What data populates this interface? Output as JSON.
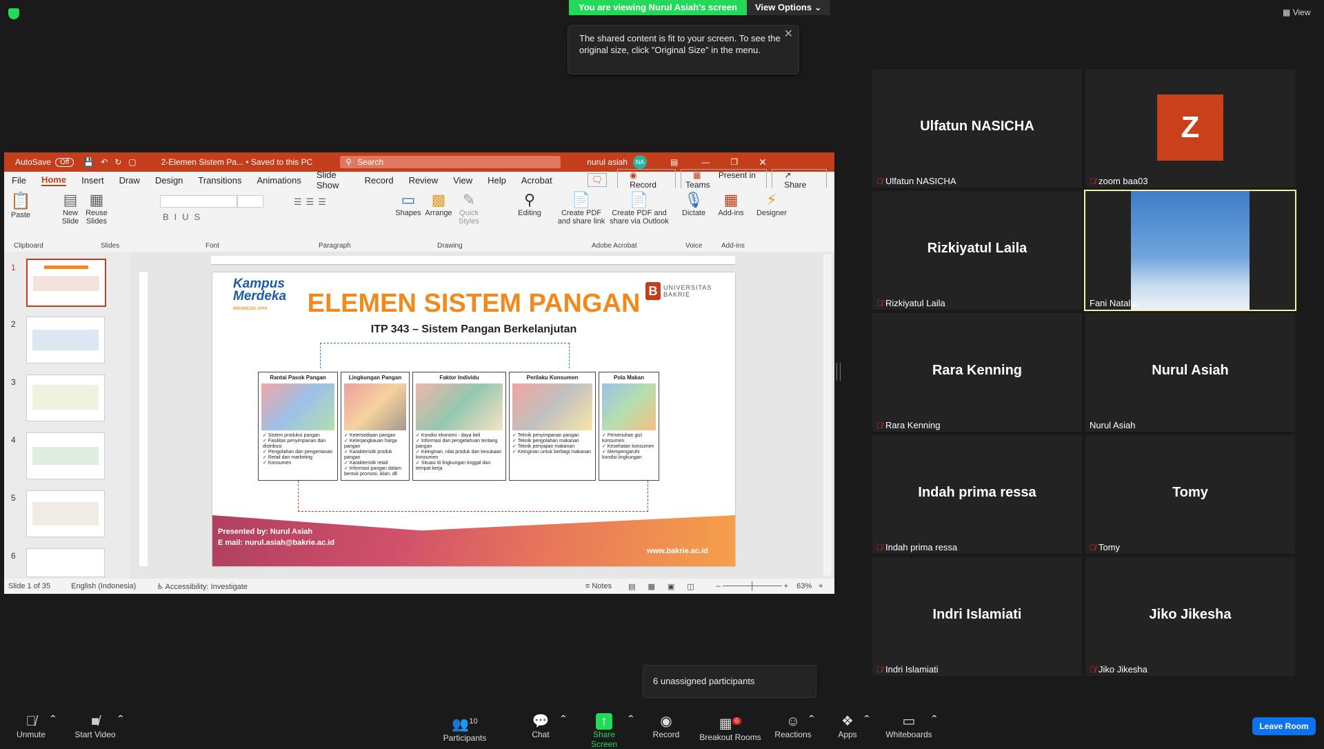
{
  "banner": {
    "viewing": "You are viewing Nurul Asiah's screen",
    "view_options": "View Options"
  },
  "tooltip": {
    "text": "The shared content is fit to your screen. To see the original size, click \"Original Size\" in the menu."
  },
  "top_view": "View",
  "ppt": {
    "autosave": "AutoSave",
    "autosave_state": "Off",
    "doc_title": "2-Elemen Sistem Pa... • Saved to this PC",
    "search": "Search",
    "user": "nurul asiah",
    "user_initials": "NA",
    "menu": [
      "File",
      "Home",
      "Insert",
      "Draw",
      "Design",
      "Transitions",
      "Animations",
      "Slide Show",
      "Record",
      "Review",
      "View",
      "Help",
      "Acrobat"
    ],
    "record_btn": "Record",
    "present_btn": "Present in Teams",
    "share_btn": "Share",
    "ribbon": {
      "paste": "Paste",
      "new_slide": "New Slide",
      "reuse_slides": "Reuse Slides",
      "shapes": "Shapes",
      "arrange": "Arrange",
      "quick_styles": "Quick Styles",
      "editing": "Editing",
      "create_pdf_link": "Create PDF and share link",
      "create_pdf_outlook": "Create PDF and share via Outlook",
      "dictate": "Dictate",
      "addins": "Add-ins",
      "designer": "Designer",
      "groups": [
        "Clipboard",
        "Slides",
        "Font",
        "Paragraph",
        "Drawing",
        "Adobe Acrobat",
        "Voice",
        "Add-ins"
      ]
    },
    "slide_numbers": [
      "1",
      "2",
      "3",
      "4",
      "5",
      "6"
    ],
    "slide": {
      "logo_left": "Kampus Merdeka",
      "logo_left_sub": "INDONESIA JAYA",
      "logo_right": "UNIVERSITAS BAKRIE",
      "title": "ELEMEN SISTEM PANGAN",
      "subtitle": "ITP 343 – Sistem Pangan Berkelanjutan",
      "boxes": [
        {
          "title": "Rantai Pasok Pangan",
          "items": [
            "Sistem produksi pangan",
            "Fasilitas penyimpanan dan distribusi",
            "Pengolahan dan pengemasan",
            "Retail dan marketing",
            "Konsumen"
          ]
        },
        {
          "title": "Lingkungan Pangan",
          "items": [
            "Ketersediaan pangan",
            "Keterjangkauan harga pangan",
            "Karakteristik produk pangan",
            "Karakteristik retail",
            "Informasi pangan dalam bentuk promosi, iklan, dll"
          ]
        },
        {
          "title": "Faktor Individu",
          "items": [
            "Kondisi ekonomi - daya beli",
            "Informasi dan pengetahuan tentang pangan",
            "Keinginan, nilai produk dan kesukaan konsumen",
            "Situasi di lingkungan tinggal dan tempat kerja"
          ]
        },
        {
          "title": "Perilaku Konsumen",
          "items": [
            "Teknik penyimpanan pangan",
            "Teknik pengolahan makanan",
            "Teknik penyajian makanan",
            "Keinginan untuk berbagi makanan"
          ]
        },
        {
          "title": "Pola Makan",
          "items": [
            "Pemenuhan gizi konsumen",
            "Kesehatan konsumen",
            "Mempengaruhi kondisi lingkungan"
          ]
        }
      ],
      "presented_by": "Presented by: Nurul Asiah",
      "email": "E mail: nurul.asiah@bakrie.ac.id",
      "website": "www.bakrie.ac.id"
    },
    "status": {
      "slide": "Slide 1 of 35",
      "lang": "English (Indonesia)",
      "accessibility": "Accessibility: Investigate",
      "notes": "Notes",
      "zoom": "63%"
    }
  },
  "participants": [
    {
      "name": "Ulfatun NASICHA",
      "label": "Ulfatun NASICHA",
      "muted": true
    },
    {
      "name": "",
      "label": "zoom baa03",
      "muted": true,
      "avatar": "Z"
    },
    {
      "name": "Rizkiyatul Laila",
      "label": "Rizkiyatul Laila",
      "muted": true
    },
    {
      "name": "",
      "label": "Fani Natalia",
      "muted": false,
      "video": true
    },
    {
      "name": "Rara Kenning",
      "label": "Rara Kenning",
      "muted": true
    },
    {
      "name": "Nurul Asiah",
      "label": "Nurul Asiah",
      "muted": false
    },
    {
      "name": "Indah prima ressa",
      "label": "Indah prima ressa",
      "muted": true
    },
    {
      "name": "Tomy",
      "label": "Tomy",
      "muted": true
    },
    {
      "name": "Indri Islamiati",
      "label": "Indri Islamiati",
      "muted": true
    },
    {
      "name": "Jiko Jikesha",
      "label": "Jiko Jikesha",
      "muted": true
    }
  ],
  "unassigned": "6 unassigned participants",
  "toolbar": {
    "unmute": "Unmute",
    "start_video": "Start Video",
    "participants": "Participants",
    "participants_count": "10",
    "chat": "Chat",
    "share_screen": "Share Screen",
    "record": "Record",
    "breakout": "Breakout Rooms",
    "breakout_count": "6",
    "reactions": "Reactions",
    "apps": "Apps",
    "whiteboards": "Whiteboards",
    "leave": "Leave Room"
  },
  "colors": {
    "zoom_green": "#23d959",
    "ppt_red": "#c43e1c",
    "slide_orange": "#f08a1c",
    "leave_blue": "#0e72ed",
    "avatar_z": "#c9401a",
    "active_border": "#f5f5a0"
  }
}
